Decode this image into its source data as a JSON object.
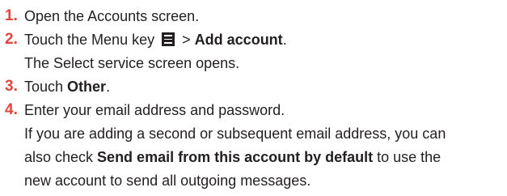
{
  "steps": [
    {
      "number": "1.",
      "text": "Open the Accounts screen."
    },
    {
      "number": "2.",
      "prefix": "Touch the Menu key",
      "separator": ">",
      "bold": "Add account",
      "suffix": ".",
      "icon": "menu-key-icon",
      "note": "The Select service screen opens."
    },
    {
      "number": "3.",
      "prefix": "Touch ",
      "bold": "Other",
      "suffix": "."
    },
    {
      "number": "4.",
      "text": "Enter your email address and password.",
      "note_line1": "If you are adding a second or subsequent email address, you can",
      "note_line2_prefix": "also check ",
      "note_line2_bold": "Send email from this account by default",
      "note_line2_suffix": " to use the",
      "note_line3": "new account to send all outgoing messages."
    }
  ]
}
